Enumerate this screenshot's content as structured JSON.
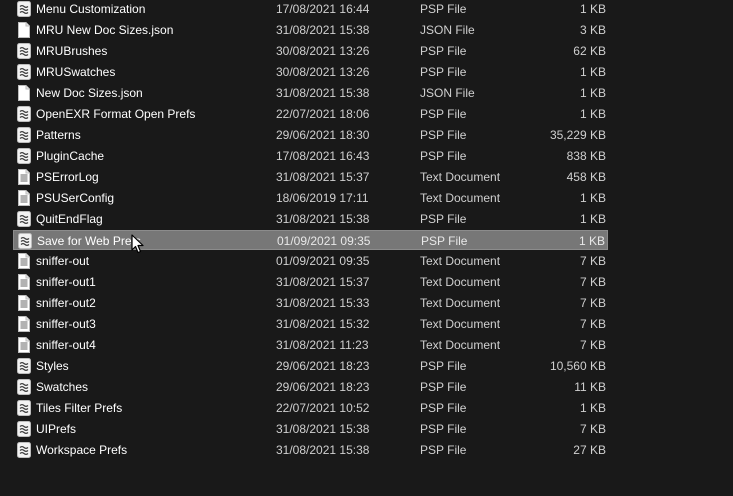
{
  "files": [
    {
      "name": "Menu Customization",
      "date": "17/08/2021 16:44",
      "type": "PSP File",
      "size": "1 KB",
      "icon": "psp-file-icon",
      "selected": false
    },
    {
      "name": "MRU New Doc Sizes.json",
      "date": "31/08/2021 15:38",
      "type": "JSON File",
      "size": "3 KB",
      "icon": "document-icon",
      "selected": false
    },
    {
      "name": "MRUBrushes",
      "date": "30/08/2021 13:26",
      "type": "PSP File",
      "size": "62 KB",
      "icon": "psp-file-icon",
      "selected": false
    },
    {
      "name": "MRUSwatches",
      "date": "30/08/2021 13:26",
      "type": "PSP File",
      "size": "1 KB",
      "icon": "psp-file-icon",
      "selected": false
    },
    {
      "name": "New Doc Sizes.json",
      "date": "31/08/2021 15:38",
      "type": "JSON File",
      "size": "1 KB",
      "icon": "document-icon",
      "selected": false
    },
    {
      "name": "OpenEXR Format Open Prefs",
      "date": "22/07/2021 18:06",
      "type": "PSP File",
      "size": "1 KB",
      "icon": "psp-file-icon",
      "selected": false
    },
    {
      "name": "Patterns",
      "date": "29/06/2021 18:30",
      "type": "PSP File",
      "size": "35,229 KB",
      "icon": "psp-file-icon",
      "selected": false
    },
    {
      "name": "PluginCache",
      "date": "17/08/2021 16:43",
      "type": "PSP File",
      "size": "838 KB",
      "icon": "psp-file-icon",
      "selected": false
    },
    {
      "name": "PSErrorLog",
      "date": "31/08/2021 15:37",
      "type": "Text Document",
      "size": "458 KB",
      "icon": "text-document-icon",
      "selected": false
    },
    {
      "name": "PSUSerConfig",
      "date": "18/06/2019 17:11",
      "type": "Text Document",
      "size": "1 KB",
      "icon": "text-document-icon",
      "selected": false
    },
    {
      "name": "QuitEndFlag",
      "date": "31/08/2021 15:38",
      "type": "PSP File",
      "size": "1 KB",
      "icon": "psp-file-icon",
      "selected": false
    },
    {
      "name": "Save for Web Prefs",
      "date": "01/09/2021 09:35",
      "type": "PSP File",
      "size": "1 KB",
      "icon": "psp-file-icon",
      "selected": true
    },
    {
      "name": "sniffer-out",
      "date": "01/09/2021 09:35",
      "type": "Text Document",
      "size": "7 KB",
      "icon": "text-document-icon",
      "selected": false
    },
    {
      "name": "sniffer-out1",
      "date": "31/08/2021 15:37",
      "type": "Text Document",
      "size": "7 KB",
      "icon": "text-document-icon",
      "selected": false
    },
    {
      "name": "sniffer-out2",
      "date": "31/08/2021 15:33",
      "type": "Text Document",
      "size": "7 KB",
      "icon": "text-document-icon",
      "selected": false
    },
    {
      "name": "sniffer-out3",
      "date": "31/08/2021 15:32",
      "type": "Text Document",
      "size": "7 KB",
      "icon": "text-document-icon",
      "selected": false
    },
    {
      "name": "sniffer-out4",
      "date": "31/08/2021 11:23",
      "type": "Text Document",
      "size": "7 KB",
      "icon": "text-document-icon",
      "selected": false
    },
    {
      "name": "Styles",
      "date": "29/06/2021 18:23",
      "type": "PSP File",
      "size": "10,560 KB",
      "icon": "psp-file-icon",
      "selected": false
    },
    {
      "name": "Swatches",
      "date": "29/06/2021 18:23",
      "type": "PSP File",
      "size": "11 KB",
      "icon": "psp-file-icon",
      "selected": false
    },
    {
      "name": "Tiles Filter Prefs",
      "date": "22/07/2021 10:52",
      "type": "PSP File",
      "size": "1 KB",
      "icon": "psp-file-icon",
      "selected": false
    },
    {
      "name": "UIPrefs",
      "date": "31/08/2021 15:38",
      "type": "PSP File",
      "size": "7 KB",
      "icon": "psp-file-icon",
      "selected": false
    },
    {
      "name": "Workspace Prefs",
      "date": "31/08/2021 15:38",
      "type": "PSP File",
      "size": "27 KB",
      "icon": "psp-file-icon",
      "selected": false
    }
  ],
  "colors": {
    "background": "#191919",
    "selected_row": "#777777",
    "text": "#ffffff"
  }
}
